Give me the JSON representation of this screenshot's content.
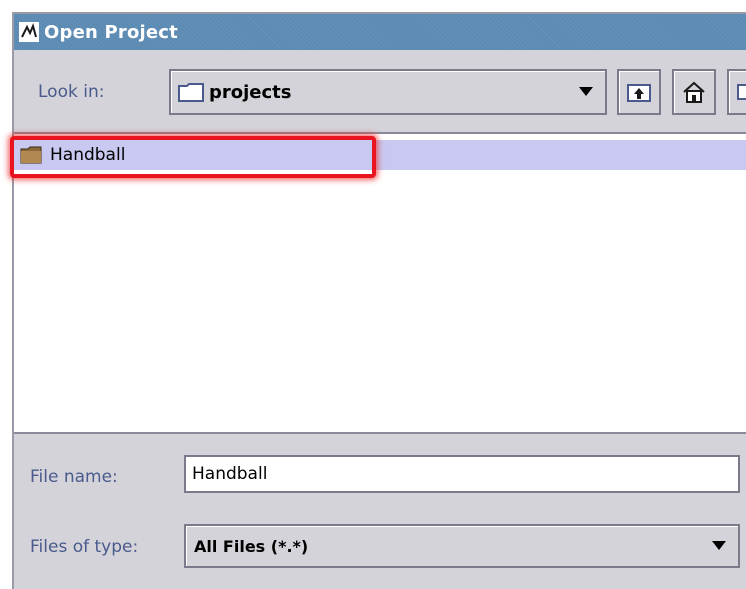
{
  "window": {
    "title": "Open Project"
  },
  "look_in": {
    "label": "Look in:",
    "value": "projects"
  },
  "toolbar": {
    "buttons": [
      "up-one-level",
      "home",
      "new-folder"
    ]
  },
  "file_list": {
    "items": [
      {
        "name": "Handball",
        "type": "folder",
        "selected": true,
        "annotated": true
      }
    ]
  },
  "file_name": {
    "label": "File name:",
    "value": "Handball"
  },
  "files_of_type": {
    "label": "Files of type:",
    "value": "All Files (*.*)"
  },
  "colors": {
    "title_bar": "#5b8ab3",
    "selection": "#c8c8f0",
    "annotation": "#e8141e",
    "label": "#4a5a8c"
  }
}
